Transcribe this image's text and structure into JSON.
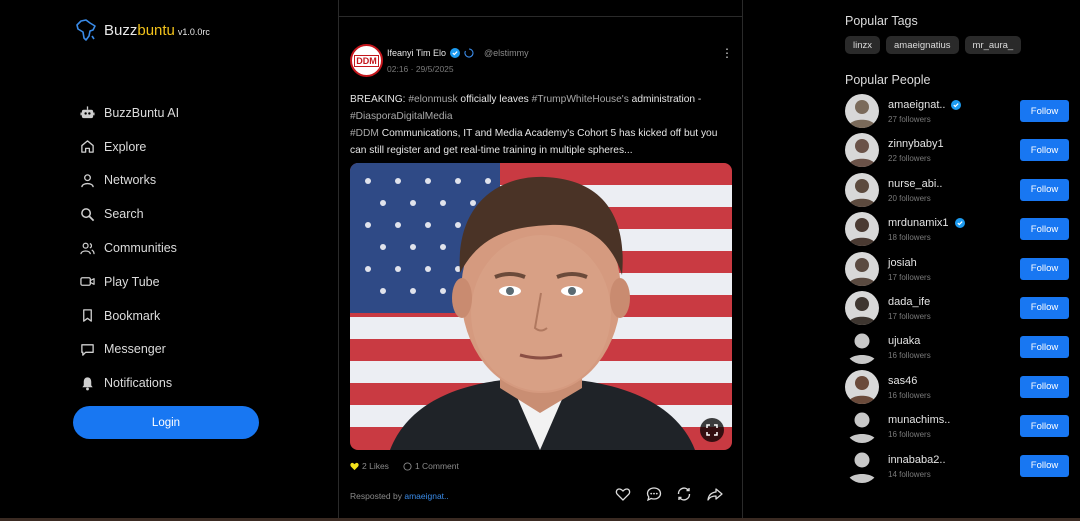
{
  "brand": {
    "name_prefix": "Buzz",
    "name_highlight": "buntu",
    "version": "v1.0.0rc"
  },
  "nav": [
    {
      "label": "BuzzBuntu AI",
      "icon": "robot-icon"
    },
    {
      "label": "Explore",
      "icon": "home-icon"
    },
    {
      "label": "Networks",
      "icon": "user-icon"
    },
    {
      "label": "Search",
      "icon": "search-icon"
    },
    {
      "label": "Communities",
      "icon": "users-icon"
    },
    {
      "label": "Play Tube",
      "icon": "video-icon"
    },
    {
      "label": "Bookmark",
      "icon": "bookmark-icon"
    },
    {
      "label": "Messenger",
      "icon": "message-icon"
    },
    {
      "label": "Notifications",
      "icon": "bell-icon"
    }
  ],
  "login_label": "Login",
  "post": {
    "avatar_text": "DDM",
    "author": "Ifeanyi Tim Elo",
    "handle": "@elstimmy",
    "time": "02:16 · 29/5/2025",
    "text_1a": "BREAKING: ",
    "text_1b": "#elonmusk",
    "text_1c": " officially leaves ",
    "text_1d": "#TrumpWhiteHouse's",
    "text_1e": " administration -",
    "text_2": "#DiasporaDigitalMedia",
    "text_3a": "#DDM",
    "text_3b": " Communications, IT and Media Academy's Cohort 5 has kicked off but you can still register and get real-time training in multiple spheres...",
    "likes": "2 Likes",
    "comments": "1 Comment",
    "reposted_prefix": "Resposted by ",
    "reposted_by": "amaeignat.."
  },
  "popular_tags_title": "Popular Tags",
  "tags": [
    "linzx",
    "amaeignatius",
    "mr_aura_"
  ],
  "popular_people_title": "Popular People",
  "follow_label": "Follow",
  "people": [
    {
      "name": "amaeignat..",
      "followers": "27 followers",
      "verified": true,
      "avatar": "photo"
    },
    {
      "name": "zinnybaby1",
      "followers": "22 followers",
      "verified": false,
      "avatar": "photo"
    },
    {
      "name": "nurse_abi..",
      "followers": "20 followers",
      "verified": false,
      "avatar": "photo"
    },
    {
      "name": "mrdunamix1",
      "followers": "18 followers",
      "verified": true,
      "avatar": "photo"
    },
    {
      "name": "josiah",
      "followers": "17 followers",
      "verified": false,
      "avatar": "photo"
    },
    {
      "name": "dada_ife",
      "followers": "17 followers",
      "verified": false,
      "avatar": "photo"
    },
    {
      "name": "ujuaka",
      "followers": "16 followers",
      "verified": false,
      "avatar": "default"
    },
    {
      "name": "sas46",
      "followers": "16 followers",
      "verified": false,
      "avatar": "photo"
    },
    {
      "name": "munachims..",
      "followers": "16 followers",
      "verified": false,
      "avatar": "default"
    },
    {
      "name": "innababa2..",
      "followers": "14 followers",
      "verified": false,
      "avatar": "default"
    }
  ],
  "colors": {
    "accent": "#1877f2",
    "brand_yellow": "#f2c21b",
    "background": "#000000",
    "like": "#f2e21b"
  }
}
